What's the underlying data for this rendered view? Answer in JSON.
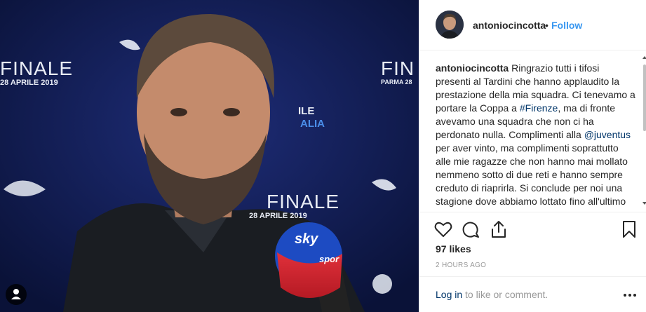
{
  "photo": {
    "bg_text_1": "FINALE",
    "bg_date_1": "28 APRILE 2019",
    "bg_text_2": "FIN",
    "bg_date_2": "PARMA 28",
    "bg_text_3": "FINALE",
    "bg_date_3": "28 APRILE 2019",
    "bg_text_4": "ALIA",
    "bg_text_5": "ILE",
    "mic_brand": "sky",
    "mic_sub": "spor",
    "user_badge_icon": "user-icon"
  },
  "post": {
    "username": "antoniocincotta",
    "separator": "•",
    "follow_label": "Follow",
    "caption_user": "antoniocincotta",
    "caption_part1": " Ringrazio tutti i tifosi presenti al Tardini che hanno applaudito la prestazione della mia squadra. Ci tenevamo a portare la Coppa a ",
    "caption_tag1": "#Firenze",
    "caption_part2": ", ma di fronte avevamo una squadra che non ci ha perdonato nulla. Complimenti alla ",
    "caption_tag2": "@juventus",
    "caption_part3": " per aver vinto, ma complimenti soprattutto alle mie ragazze che non hanno mai mollato nemmeno sotto di due reti e hanno sempre creduto di riaprirla. Si conclude per noi una stagione dove abbiamo lottato fino all'ultimo per poter",
    "likes": "97 likes",
    "timestamp": "2 HOURS AGO",
    "login_link": "Log in",
    "login_rest": " to like or comment.",
    "icons": [
      "heart-icon",
      "comment-icon",
      "share-icon",
      "bookmark-icon",
      "more-icon"
    ],
    "colors": {
      "link": "#3897f0",
      "hashtag": "#003569",
      "text": "#262626",
      "muted": "#999999"
    }
  }
}
